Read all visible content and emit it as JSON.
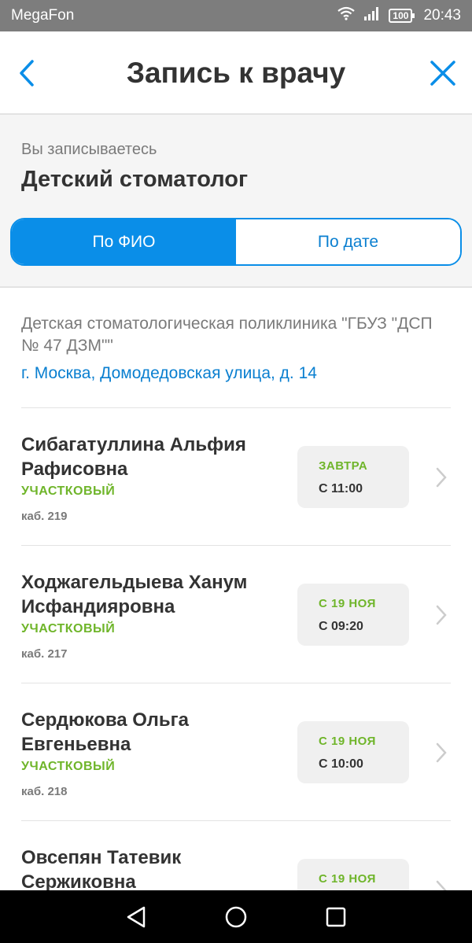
{
  "status_bar": {
    "carrier": "MegaFon",
    "battery": "100",
    "time": "20:43"
  },
  "header": {
    "title": "Запись к врачу",
    "back_icon": "chevron-left-icon",
    "close_icon": "close-icon"
  },
  "intro": {
    "subtitle": "Вы записываетесь",
    "specialty": "Детский стоматолог"
  },
  "tabs": [
    {
      "label": "По ФИО",
      "active": true
    },
    {
      "label": "По дате",
      "active": false
    }
  ],
  "clinic": {
    "name": "Детская стоматологическая поликлиника \"ГБУЗ \"ДСП № 47 ДЗМ\"\"",
    "address": "г. Москва, Домодедовская улица, д. 14"
  },
  "doctors": [
    {
      "name": "Сибагатуллина Альфия Рафисовна",
      "role": "УЧАСТКОВЫЙ",
      "cabinet": "каб. 219",
      "slot_day": "ЗАВТРА",
      "slot_time": "С 11:00"
    },
    {
      "name": "Ходжагельдыева Ханум Исфандияровна",
      "role": "УЧАСТКОВЫЙ",
      "cabinet": "каб. 217",
      "slot_day": "С 19 НОЯ",
      "slot_time": "С 09:20"
    },
    {
      "name": "Сердюкова Ольга Евгеньевна",
      "role": "УЧАСТКОВЫЙ",
      "cabinet": "каб. 218",
      "slot_day": "С 19 НОЯ",
      "slot_time": "С 10:00"
    },
    {
      "name": "Овсепян Татевик Сержиковна",
      "role": "",
      "cabinet": "",
      "slot_day": "С 19 НОЯ",
      "slot_time": ""
    }
  ],
  "colors": {
    "accent_blue": "#0a8ee8",
    "link_blue": "#0a7fd0",
    "green": "#6fb52a",
    "status_bar": "#7d7d7d"
  }
}
